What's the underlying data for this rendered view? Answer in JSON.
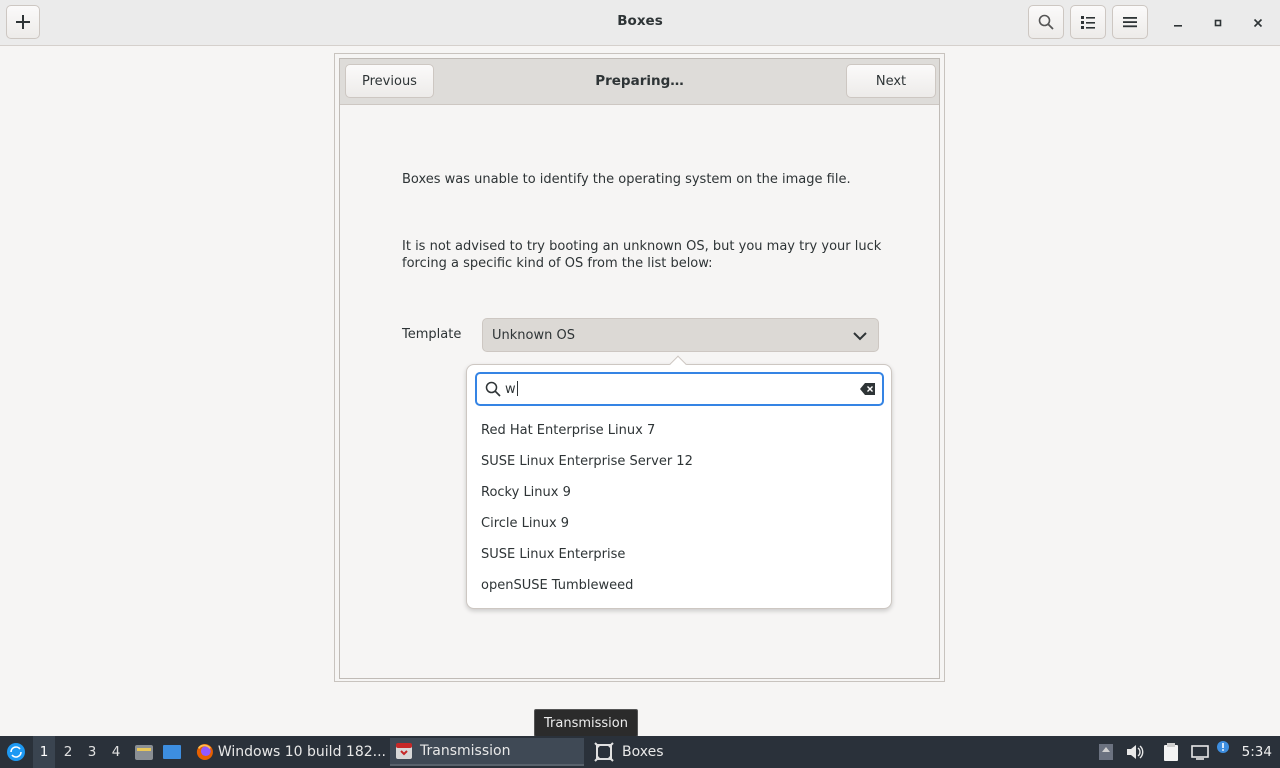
{
  "app": {
    "title": "Boxes"
  },
  "dialog": {
    "title": "Preparing…",
    "previous_label": "Previous",
    "next_label": "Next",
    "message1": "Boxes was unable to identify the operating system on the image file.",
    "message2": "It is not advised to try booting an unknown OS, but you may try your luck forcing a specific kind of OS from the list below:",
    "template_label": "Template",
    "template_value": "Unknown OS"
  },
  "popover": {
    "search_value": "w",
    "items": [
      "Red Hat Enterprise Linux 7",
      "SUSE Linux Enterprise Server 12",
      "Rocky Linux 9",
      "Circle Linux 9",
      "SUSE Linux Enterprise",
      "openSUSE Tumbleweed"
    ]
  },
  "tooltip": {
    "text": "Transmission"
  },
  "taskbar": {
    "workspaces": [
      "1",
      "2",
      "3",
      "4"
    ],
    "tasks": [
      {
        "label": "Windows 10 build 182...",
        "icon": "firefox-icon"
      },
      {
        "label": "Transmission",
        "icon": "transmission-icon"
      },
      {
        "label": "Boxes",
        "icon": "boxes-icon"
      }
    ],
    "clock": "5:34"
  },
  "colors": {
    "accent": "#3584e4",
    "taskbar_bg": "#2a313a"
  }
}
